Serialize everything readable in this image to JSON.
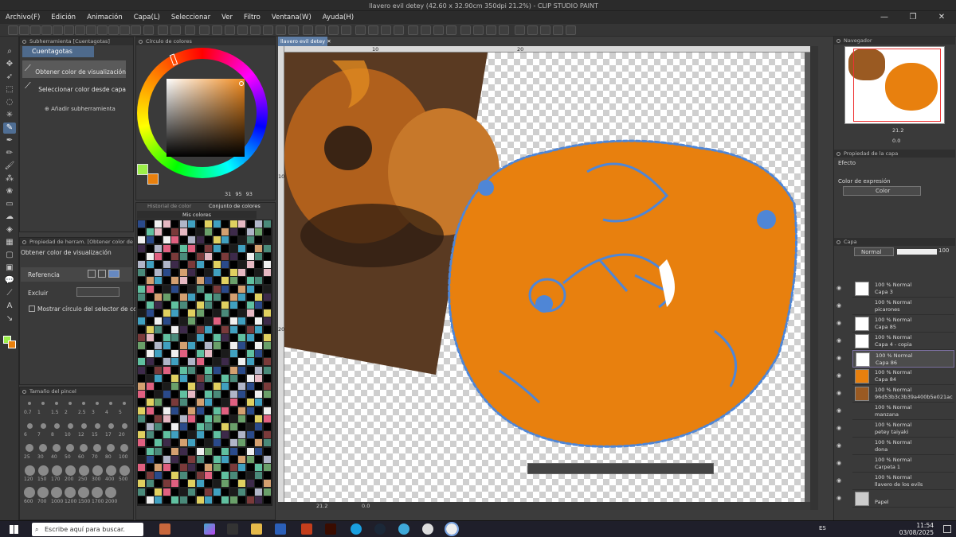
{
  "window": {
    "title": "llavero evil detey (42.60 x 32.90cm 350dpi 21.2%) - CLIP STUDIO PAINT PRO",
    "controls": [
      "—",
      "❐",
      "✕"
    ]
  },
  "menu": [
    "Archivo(F)",
    "Edición",
    "Animación",
    "Capa(L)",
    "Seleccionar",
    "Ver",
    "Filtro",
    "Ventana(W)",
    "Ayuda(H)"
  ],
  "subtool_panel": {
    "title": "Subherramienta [Cuentagotas]",
    "tab": "Cuentagotas",
    "items": [
      "Obtener color de visualización",
      "Seleccionar color desde capa"
    ],
    "add": "Añadir subherramienta"
  },
  "color_wheel": {
    "title": "Círculo de colores",
    "values": "31 95 93",
    "main_color": "#9cef4a",
    "sub_color": "#e8800e"
  },
  "color_sets": {
    "tabs": [
      "Historial de color",
      "Conjunto de colores"
    ],
    "set_name": "Mis colores"
  },
  "tool_property": {
    "title": "Propiedad de herram. [Obtener color de ...",
    "name": "Obtener color de visualización",
    "reference": "Referencia",
    "exclude": "Excluir",
    "show_wheel": "Mostrar círculo del selector de color"
  },
  "brush_size": {
    "title": "Tamaño del pincel",
    "sizes": [
      "0.7",
      "1",
      "1.5",
      "2",
      "2.5",
      "3",
      "4",
      "5",
      "6",
      "7",
      "8",
      "10",
      "12",
      "15",
      "17",
      "20",
      "25",
      "30",
      "40",
      "50",
      "60",
      "70",
      "80",
      "100",
      "120",
      "150",
      "170",
      "200",
      "250",
      "300",
      "400",
      "500",
      "600",
      "700",
      "1000",
      "1200",
      "1500",
      "1700",
      "2000"
    ]
  },
  "canvas": {
    "tab": "llavero evil detey",
    "ruler_marks": [
      "10",
      "20",
      "10",
      "20"
    ],
    "zoom": "21.2",
    "angle": "0.0"
  },
  "navigator": {
    "title": "Navegador",
    "zoom": "21.2",
    "angle": "0.0"
  },
  "layer_property": {
    "title": "Propiedad de la capa",
    "effect": "Efecto",
    "expression_label": "Color de expresión",
    "expression_value": "Color"
  },
  "layers": {
    "title": "Capa",
    "blend": "Normal",
    "opacity": "100",
    "rows": [
      {
        "mode": "100 % Normal",
        "name": "Capa 3"
      },
      {
        "mode": "100 % Normal",
        "name": "picarones"
      },
      {
        "mode": "100 % Normal",
        "name": "Capa 85"
      },
      {
        "mode": "100 % Normal",
        "name": "Capa 4 - copia"
      },
      {
        "mode": "100 % Normal",
        "name": "Capa 86"
      },
      {
        "mode": "100 % Normal",
        "name": "Capa 84"
      },
      {
        "mode": "100 % Normal",
        "name": "96d53b3c3b39a400b5e021ac"
      },
      {
        "mode": "100 % Normal",
        "name": "manzana"
      },
      {
        "mode": "100 % Normal",
        "name": "petey  taiyaki"
      },
      {
        "mode": "100 % Normal",
        "name": "dona"
      },
      {
        "mode": "100 % Normal",
        "name": "Carpeta 1"
      },
      {
        "mode": "100 % Normal",
        "name": "llavero de los evils"
      },
      {
        "mode": "",
        "name": "Papel"
      }
    ]
  },
  "taskbar": {
    "search": "Escribe aquí para buscar.",
    "lang": "ES",
    "time": "11:54",
    "date": "03/08/2025"
  },
  "colors": {
    "accent": "#5f7ea6",
    "orange": "#e8800e",
    "outline": "#4f86d6"
  }
}
